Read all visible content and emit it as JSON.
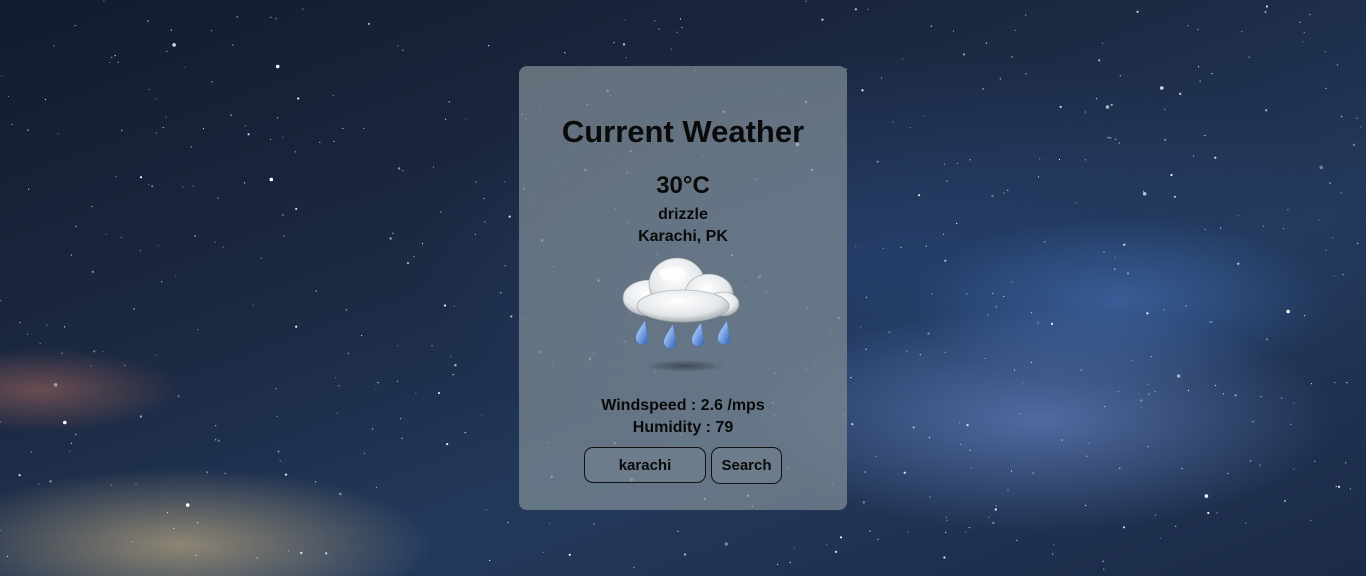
{
  "card": {
    "title": "Current Weather",
    "temperature": "30°C",
    "description": "drizzle",
    "location": "Karachi, PK",
    "weather_icon": "rain-cloud-icon",
    "windspeed": "Windspeed : 2.6 /mps",
    "humidity": "Humidity : 79"
  },
  "search": {
    "value": "karachi",
    "button_label": "Search"
  }
}
